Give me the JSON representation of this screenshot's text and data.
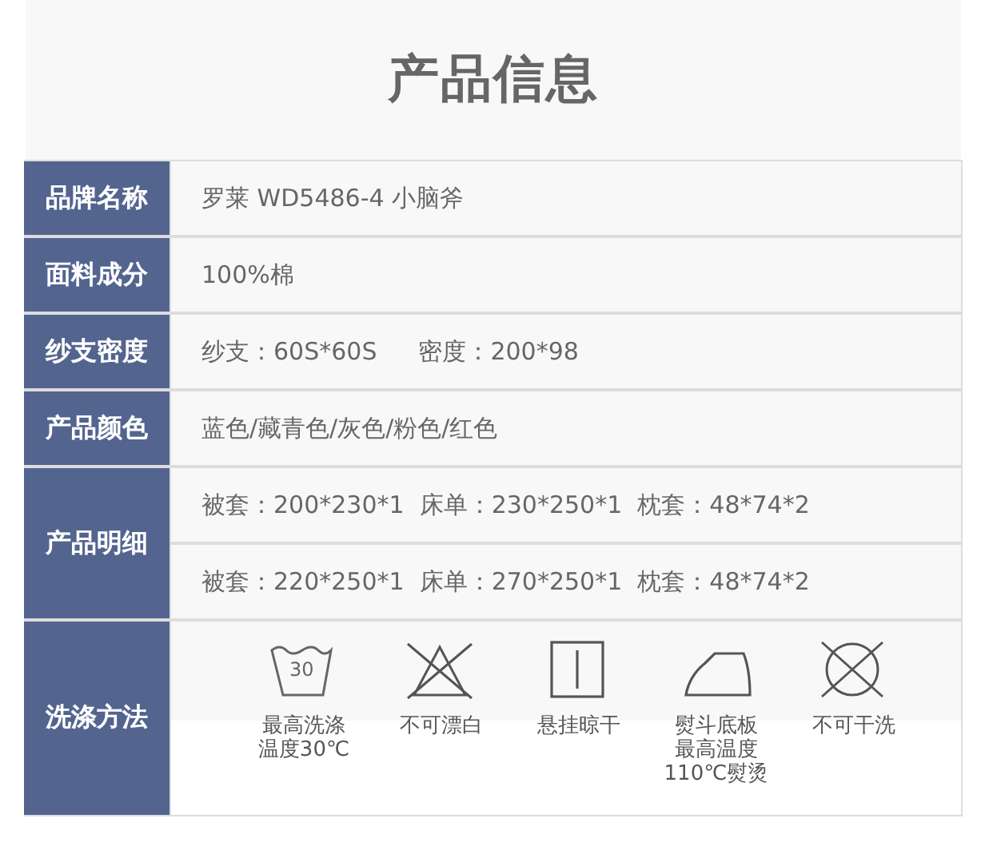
{
  "title": "产品信息",
  "rows": [
    {
      "label": "品牌名称",
      "kind": "text",
      "lines": [
        [
          "罗莱 WD5486-4 小脑斧"
        ]
      ]
    },
    {
      "label": "面料成分",
      "kind": "text",
      "lines": [
        [
          "100%棉"
        ]
      ]
    },
    {
      "label": "纱支密度",
      "kind": "text",
      "lines": [
        [
          "纱支：60S*60S",
          "密度：200*98"
        ]
      ]
    },
    {
      "label": "产品颜色",
      "kind": "text",
      "lines": [
        [
          "蓝色/藏青色/灰色/粉色/红色"
        ]
      ]
    },
    {
      "label": "产品明细",
      "kind": "text",
      "lines": [
        [
          "被套：200*230*1  床单：230*250*1  枕套：48*74*2"
        ],
        [
          "被套：220*250*1  床单：270*250*1  枕套：48*74*2"
        ]
      ]
    },
    {
      "label": "洗涤方法",
      "kind": "care",
      "items": [
        {
          "kind": "wash",
          "temp": "30",
          "label": [
            "最高洗涤",
            "温度30℃"
          ]
        },
        {
          "kind": "no-bleach",
          "label": [
            "不可漂白"
          ]
        },
        {
          "kind": "line-dry",
          "label": [
            "悬挂晾干"
          ]
        },
        {
          "kind": "iron",
          "label": [
            "熨斗底板",
            "最高温度",
            "110℃熨烫"
          ]
        },
        {
          "kind": "no-dry-clean",
          "label": [
            "不可干洗"
          ]
        }
      ]
    }
  ]
}
